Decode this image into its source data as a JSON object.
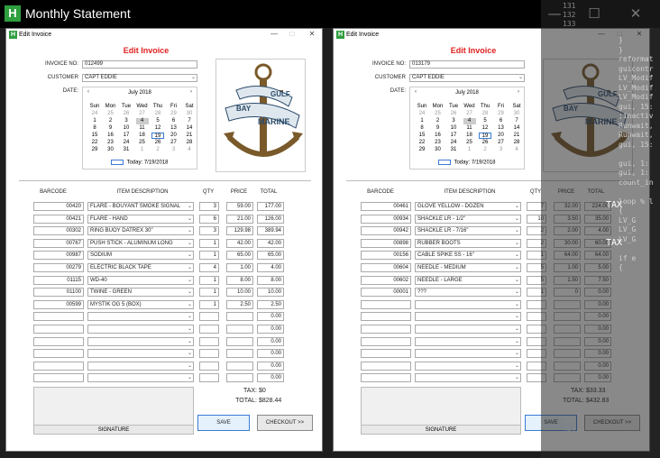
{
  "app": {
    "title": "Monthly Statement",
    "icon": "H"
  },
  "windows": [
    {
      "title": "Edit Invoice",
      "heading": "Edit Invoice",
      "labels": {
        "invoice_no": "INVOICE NO:",
        "customer": "CUSTOMER",
        "date": "DATE:"
      },
      "invoice_no": "012499",
      "customer": "CAPT EDDIE",
      "calendar": {
        "month": "July 2018",
        "dow": [
          "Sun",
          "Mon",
          "Tue",
          "Wed",
          "Thu",
          "Fri",
          "Sat"
        ],
        "weeks": [
          [
            "24",
            "25",
            "26",
            "27",
            "28",
            "29",
            "30"
          ],
          [
            "1",
            "2",
            "3",
            "4",
            "5",
            "6",
            "7"
          ],
          [
            "8",
            "9",
            "10",
            "11",
            "12",
            "13",
            "14"
          ],
          [
            "15",
            "16",
            "17",
            "18",
            "19",
            "20",
            "21"
          ],
          [
            "22",
            "23",
            "24",
            "25",
            "26",
            "27",
            "28"
          ],
          [
            "29",
            "30",
            "31",
            "1",
            "2",
            "3",
            "4"
          ]
        ],
        "today": "Today: 7/19/2018"
      },
      "logo": {
        "line1": "GULF",
        "line2": "BAY",
        "line3": "MARINE"
      },
      "columns": {
        "barcode": "BARCODE",
        "desc": "ITEM DESCRIPTION",
        "qty": "QTY",
        "price": "PRICE",
        "total": "TOTAL"
      },
      "rows": [
        {
          "barcode": "00420",
          "desc": "FLARE - BOUYANT SMOKE SIGNAL",
          "qty": "3",
          "price": "59.00",
          "total": "177.00"
        },
        {
          "barcode": "00421",
          "desc": "FLARE - HAND",
          "qty": "6",
          "price": "21.00",
          "total": "126.00"
        },
        {
          "barcode": "00302",
          "desc": "RING BUOY DATREX 30\"",
          "qty": "3",
          "price": "129.98",
          "total": "389.94"
        },
        {
          "barcode": "00767",
          "desc": "PUSH STICK - ALUMINUM LONG",
          "qty": "1",
          "price": "42.00",
          "total": "42.00"
        },
        {
          "barcode": "00987",
          "desc": "SODIUM",
          "qty": "1",
          "price": "65.00",
          "total": "65.00"
        },
        {
          "barcode": "00279",
          "desc": "ELECTRIC BLACK TAPE",
          "qty": "4",
          "price": "1.00",
          "total": "4.00"
        },
        {
          "barcode": "01115",
          "desc": "WD-40",
          "qty": "1",
          "price": "8.00",
          "total": "8.00"
        },
        {
          "barcode": "01100",
          "desc": "TWINE - GREEN",
          "qty": "1",
          "price": "10.00",
          "total": "10.00"
        },
        {
          "barcode": "00599",
          "desc": "MYSTIK OG 5 (BOX)",
          "qty": "1",
          "price": "2.50",
          "total": "2.50"
        },
        {
          "barcode": "",
          "desc": "",
          "qty": "",
          "price": "",
          "total": "0.00"
        },
        {
          "barcode": "",
          "desc": "",
          "qty": "",
          "price": "",
          "total": "0.00"
        },
        {
          "barcode": "",
          "desc": "",
          "qty": "",
          "price": "",
          "total": "0.00"
        },
        {
          "barcode": "",
          "desc": "",
          "qty": "",
          "price": "",
          "total": "0.00"
        },
        {
          "barcode": "",
          "desc": "",
          "qty": "",
          "price": "",
          "total": "0.00"
        },
        {
          "barcode": "",
          "desc": "",
          "qty": "",
          "price": "",
          "total": "0.00"
        }
      ],
      "tax_label": "TAX:",
      "tax": "$0",
      "total_label": "TOTAL:",
      "total": "$828.44",
      "signature": "SIGNATURE",
      "save": "SAVE",
      "checkout": "CHECKOUT >>"
    },
    {
      "title": "Edit Invoice",
      "heading": "Edit Invoice",
      "labels": {
        "invoice_no": "INVOICE NO:",
        "customer": "CUSTOMER",
        "date": "DATE:"
      },
      "invoice_no": "013179",
      "customer": "CAPT EDDIE",
      "calendar": {
        "month": "July 2018",
        "dow": [
          "Sun",
          "Mon",
          "Tue",
          "Wed",
          "Thu",
          "Fri",
          "Sat"
        ],
        "weeks": [
          [
            "24",
            "25",
            "26",
            "27",
            "28",
            "29",
            "30"
          ],
          [
            "1",
            "2",
            "3",
            "4",
            "5",
            "6",
            "7"
          ],
          [
            "8",
            "9",
            "10",
            "11",
            "12",
            "13",
            "14"
          ],
          [
            "15",
            "16",
            "17",
            "18",
            "19",
            "20",
            "21"
          ],
          [
            "22",
            "23",
            "24",
            "25",
            "26",
            "27",
            "28"
          ],
          [
            "29",
            "30",
            "31",
            "1",
            "2",
            "3",
            "4"
          ]
        ],
        "today": "Today: 7/19/2018"
      },
      "logo": {
        "line1": "GULF",
        "line2": "BAY",
        "line3": "MARINE"
      },
      "columns": {
        "barcode": "BARCODE",
        "desc": "ITEM DESCRIPTION",
        "qty": "QTY",
        "price": "PRICE",
        "total": "TOTAL"
      },
      "rows": [
        {
          "barcode": "00461",
          "desc": "GLOVE YELLOW - DOZEN",
          "qty": "7",
          "price": "32.00",
          "total": "224.00"
        },
        {
          "barcode": "00934",
          "desc": "SHACKLE LR - 1/2\"",
          "qty": "10",
          "price": "3.50",
          "total": "35.00"
        },
        {
          "barcode": "00942",
          "desc": "SHACKLE LR - 7/16\"",
          "qty": "2",
          "price": "2.00",
          "total": "4.00"
        },
        {
          "barcode": "00898",
          "desc": "RUBBER BOOTS",
          "qty": "2",
          "price": "30.00",
          "total": "60.00"
        },
        {
          "barcode": "00156",
          "desc": "CABLE SPIKE SS - 16\"",
          "qty": "1",
          "price": "64.00",
          "total": "64.00"
        },
        {
          "barcode": "00604",
          "desc": "NEEDLE - MEDIUM",
          "qty": "5",
          "price": "1.00",
          "total": "5.00"
        },
        {
          "barcode": "00602",
          "desc": "NEEDLE - LARGE",
          "qty": "5",
          "price": "1.50",
          "total": "7.50"
        },
        {
          "barcode": "00001",
          "desc": "???",
          "qty": "1",
          "price": "0",
          "total": "0.00"
        },
        {
          "barcode": "",
          "desc": "",
          "qty": "",
          "price": "",
          "total": "0.00"
        },
        {
          "barcode": "",
          "desc": "",
          "qty": "",
          "price": "",
          "total": "0.00"
        },
        {
          "barcode": "",
          "desc": "",
          "qty": "",
          "price": "",
          "total": "0.00"
        },
        {
          "barcode": "",
          "desc": "",
          "qty": "",
          "price": "",
          "total": "0.00"
        },
        {
          "barcode": "",
          "desc": "",
          "qty": "",
          "price": "",
          "total": "0.00"
        },
        {
          "barcode": "",
          "desc": "",
          "qty": "",
          "price": "",
          "total": "0.00"
        },
        {
          "barcode": "",
          "desc": "",
          "qty": "",
          "price": "",
          "total": "0.00"
        }
      ],
      "tax_label": "TAX:",
      "tax": "$33.33",
      "total_label": "TOTAL:",
      "total": "$432.83",
      "signature": "SIGNATURE",
      "save": "SAVE",
      "checkout": "CHECKOUT >>"
    }
  ],
  "code_panel": {
    "lines": [
      {
        "ln": "131",
        "text": ""
      },
      {
        "ln": "132",
        "text": ""
      },
      {
        "ln": "133",
        "text": ""
      },
      {
        "ln": "134",
        "text": ""
      },
      {
        "ln": "",
        "text": "}"
      },
      {
        "ln": "",
        "text": "}"
      },
      {
        "ln": "",
        "text": "reformat"
      },
      {
        "ln": "",
        "text": "guicontr"
      },
      {
        "ln": "",
        "text": "LV_Modif"
      },
      {
        "ln": "",
        "text": "LV_Modif"
      },
      {
        "ln": "",
        "text": "LV_Modif"
      },
      {
        "ln": "",
        "text": "gui, 15:"
      },
      {
        "ln": "",
        "text": ";inactiv"
      },
      {
        "ln": "",
        "text": "Runwait,"
      },
      {
        "ln": "",
        "text": "Runwait,"
      },
      {
        "ln": "",
        "text": "gui, 15:"
      },
      {
        "ln": "",
        "text": ""
      },
      {
        "ln": "",
        "text": "gui, 1:"
      },
      {
        "ln": "",
        "text": "gui, 1:"
      },
      {
        "ln": "",
        "text": "count_in"
      },
      {
        "ln": "",
        "text": ""
      },
      {
        "ln": "",
        "text": "loop % l"
      },
      {
        "ln": "",
        "text": "{"
      },
      {
        "ln": "",
        "text": "  LV_G"
      },
      {
        "ln": "",
        "text": "  LV_G"
      },
      {
        "ln": "",
        "text": "  LV_G"
      },
      {
        "ln": "",
        "text": ""
      },
      {
        "ln": "",
        "text": "  if e"
      },
      {
        "ln": "",
        "text": "  {"
      }
    ],
    "tax_words": [
      "TAX",
      "TAX"
    ],
    "bottom_lines": [
      "165",
      "166",
      "167",
      "168"
    ]
  }
}
